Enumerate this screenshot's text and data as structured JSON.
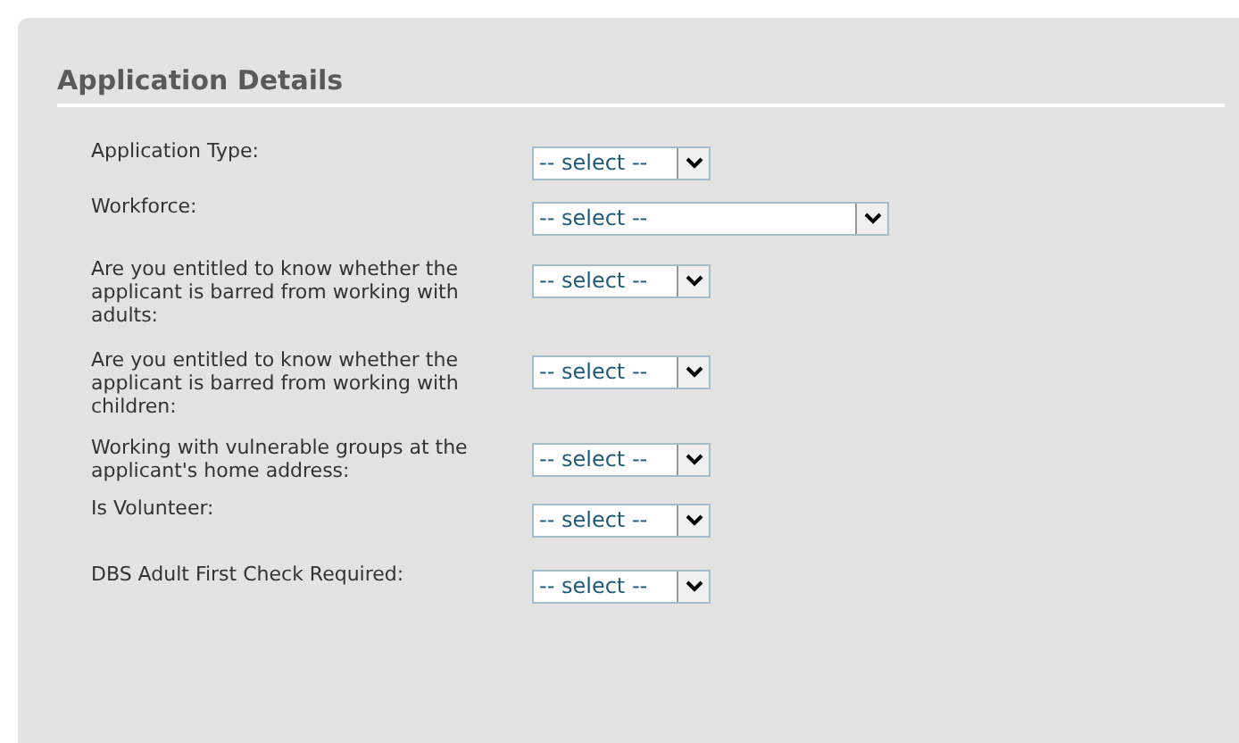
{
  "section": {
    "title": "Application Details"
  },
  "fields": [
    {
      "label": "Application Type:",
      "value": "-- select --",
      "kind": "short"
    },
    {
      "label": "Workforce:",
      "value": "-- select --",
      "kind": "wide"
    },
    {
      "label": "Are you entitled to know whether the applicant is barred from working with adults:",
      "value": "-- select --",
      "kind": "short"
    },
    {
      "label": "Are you entitled to know whether the applicant is barred from working with children:",
      "value": "-- select --",
      "kind": "short"
    },
    {
      "label": "Working with vulnerable groups at the applicant's home address:",
      "value": "-- select --",
      "kind": "short"
    },
    {
      "label": "Is Volunteer:",
      "value": "-- select --",
      "kind": "short"
    },
    {
      "label": "DBS Adult First Check Required:",
      "value": "-- select --",
      "kind": "short"
    }
  ]
}
